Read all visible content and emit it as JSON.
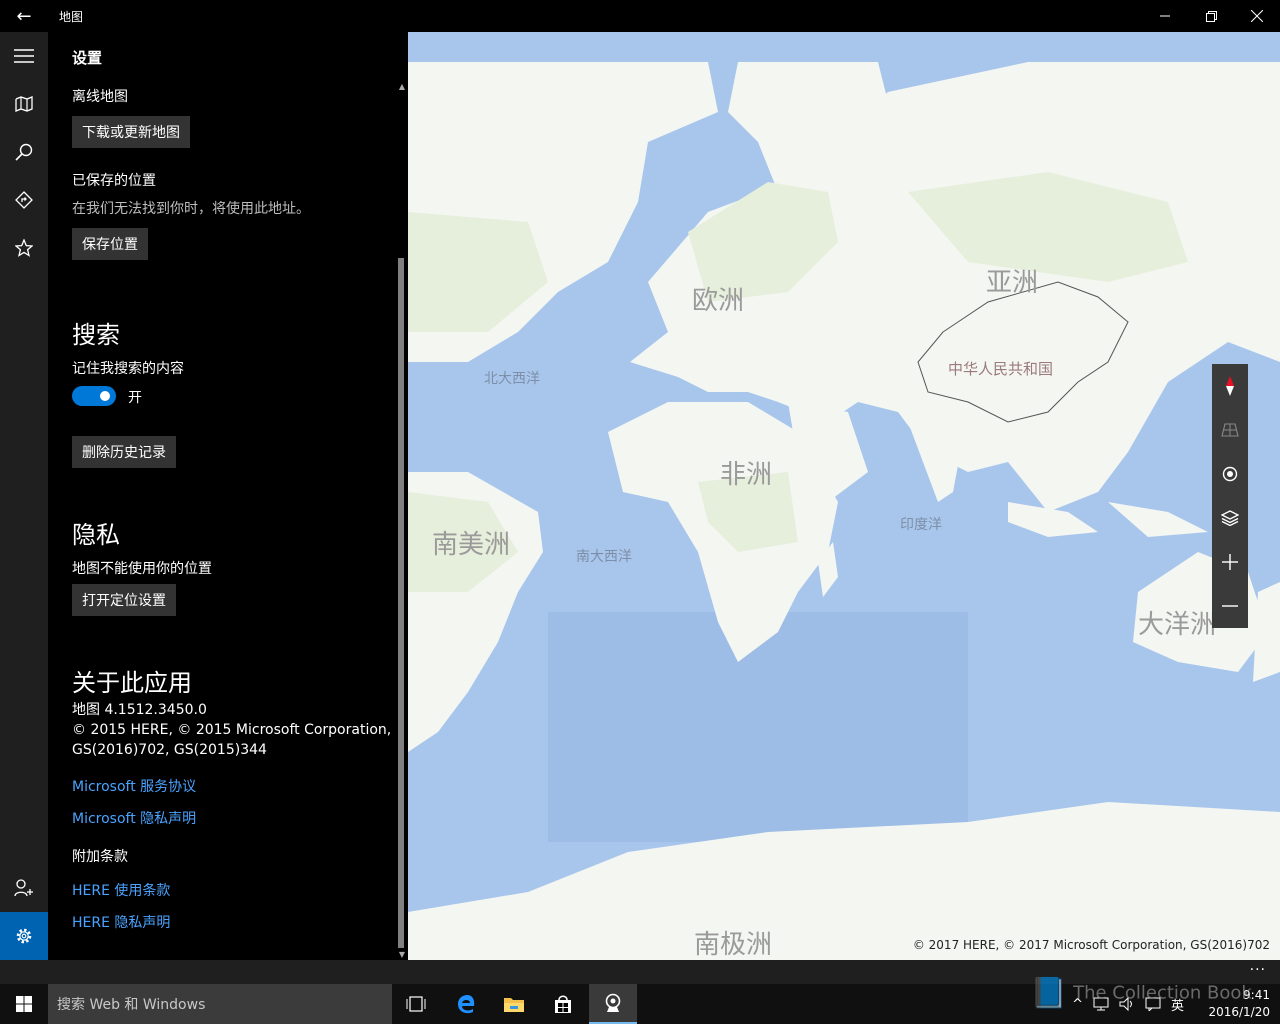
{
  "window": {
    "title": "地图",
    "back_glyph": "←",
    "minimize_glyph": "—",
    "restore_glyph": "❐",
    "close_glyph": "✕"
  },
  "rail": {
    "icons": [
      "hamburger-menu-icon",
      "map-icon",
      "search-icon",
      "directions-icon",
      "favorites-star-icon",
      "account-add-icon",
      "settings-gear-icon"
    ],
    "active": "settings-gear-icon"
  },
  "settings": {
    "title": "设置",
    "offline": {
      "label": "离线地图",
      "button": "下载或更新地图"
    },
    "saved_location": {
      "label": "已保存的位置",
      "description": "在我们无法找到你时，将使用此地址。",
      "button": "保存位置"
    },
    "search": {
      "heading": "搜索",
      "remember_label": "记住我搜索的内容",
      "toggle_state": "开",
      "toggle_on": true,
      "clear_button": "删除历史记录"
    },
    "privacy": {
      "heading": "隐私",
      "location_status": "地图不能使用你的位置",
      "button": "打开定位设置"
    },
    "about": {
      "heading": "关于此应用",
      "version": "地图 4.1512.3450.0",
      "copyright_line1": "© 2015 HERE, © 2015 Microsoft Corporation,",
      "copyright_line2": "GS(2016)702, GS(2015)344",
      "link_service": "Microsoft 服务协议",
      "link_privacy": "Microsoft 隐私声明",
      "additional_terms_label": "附加条款",
      "link_here_terms": "HERE 使用条款",
      "link_here_privacy": "HERE 隐私声明"
    }
  },
  "map": {
    "labels": {
      "europe": "欧洲",
      "asia": "亚洲",
      "china": "中华人民共和国",
      "north_atlantic": "北大西洋",
      "africa": "非洲",
      "south_america": "南美洲",
      "south_atlantic": "南大西洋",
      "indian_ocean": "印度洋",
      "oceania": "大洋洲",
      "antarctica": "南极洲"
    },
    "copyright": "© 2017 HERE, © 2017 Microsoft Corporation, GS(2016)702",
    "colors": {
      "ocean": "#a8c6ec",
      "land": "#f4f6f2",
      "vegetation": "#e6efdc"
    },
    "controls": [
      "compass-icon",
      "tilt-3d-icon",
      "locate-me-icon",
      "map-layers-icon",
      "zoom-in-icon",
      "zoom-out-icon"
    ]
  },
  "appbar": {
    "more": "···"
  },
  "taskbar": {
    "search_placeholder": "搜索 Web 和 Windows",
    "apps": [
      "task-view-icon",
      "edge-browser-icon",
      "file-explorer-icon",
      "store-icon",
      "maps-app-icon"
    ],
    "tray_language": "英",
    "time": "9:41",
    "date": "2016/1/20"
  },
  "watermark": "The Collection Book"
}
